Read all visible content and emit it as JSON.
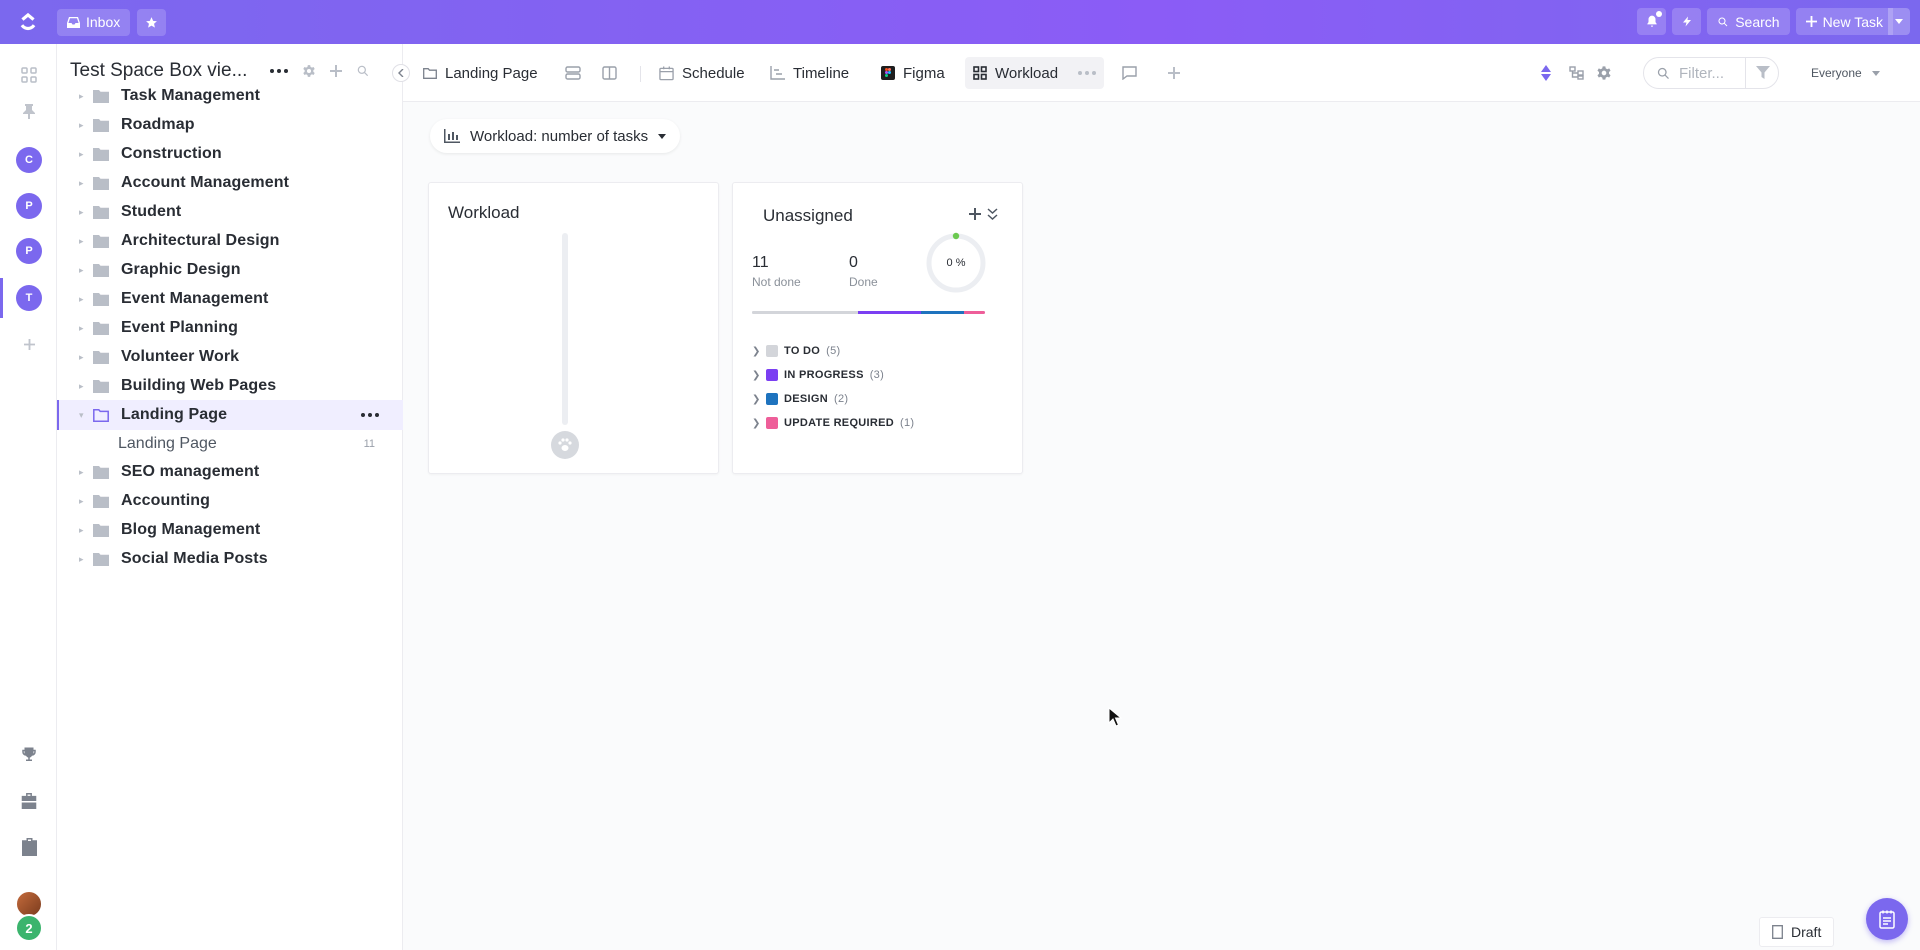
{
  "topbar": {
    "inbox_label": "Inbox",
    "search_label": "Search",
    "new_task_label": "New Task"
  },
  "rail": {
    "avatars": [
      "C",
      "P",
      "P",
      "T"
    ],
    "badge_count": "2"
  },
  "sidebar": {
    "space_title": "Test Space Box vie...",
    "folders": [
      {
        "label": "Task Management"
      },
      {
        "label": "Roadmap"
      },
      {
        "label": "Construction"
      },
      {
        "label": "Account Management"
      },
      {
        "label": "Student"
      },
      {
        "label": "Architectural Design"
      },
      {
        "label": "Graphic Design"
      },
      {
        "label": "Event Management"
      },
      {
        "label": "Event Planning"
      },
      {
        "label": "Volunteer Work"
      },
      {
        "label": "Building Web Pages"
      },
      {
        "label": "Landing Page"
      },
      {
        "label": "SEO management"
      },
      {
        "label": "Accounting"
      },
      {
        "label": "Blog Management"
      },
      {
        "label": "Social Media Posts"
      }
    ],
    "active_list": {
      "label": "Landing Page",
      "count": "11"
    }
  },
  "viewbar": {
    "breadcrumb": "Landing Page",
    "tabs": [
      "Schedule",
      "Timeline",
      "Figma",
      "Workload"
    ],
    "filter_placeholder": "Filter...",
    "assignee_filter": "Everyone"
  },
  "main": {
    "workload_dropdown": "Workload: number of tasks",
    "workload_card_title": "Workload",
    "unassigned": {
      "title": "Unassigned",
      "not_done_value": "11",
      "not_done_label": "Not done",
      "done_value": "0",
      "done_label": "Done",
      "percent": "0 %",
      "statuses": [
        {
          "label": "TO DO",
          "count": "(5)",
          "color": "#d3d5da"
        },
        {
          "label": "IN PROGRESS",
          "count": "(3)",
          "color": "#7b3ff2"
        },
        {
          "label": "DESIGN",
          "count": "(2)",
          "color": "#1e73be"
        },
        {
          "label": "UPDATE REQUIRED",
          "count": "(1)",
          "color": "#ee5e99"
        }
      ]
    }
  },
  "footer": {
    "draft_label": "Draft"
  },
  "colors": {
    "brand": "#7b68ee",
    "progress_segments": [
      "#d3d5da",
      "#7b3ff2",
      "#1e73be",
      "#ee5e99"
    ]
  }
}
